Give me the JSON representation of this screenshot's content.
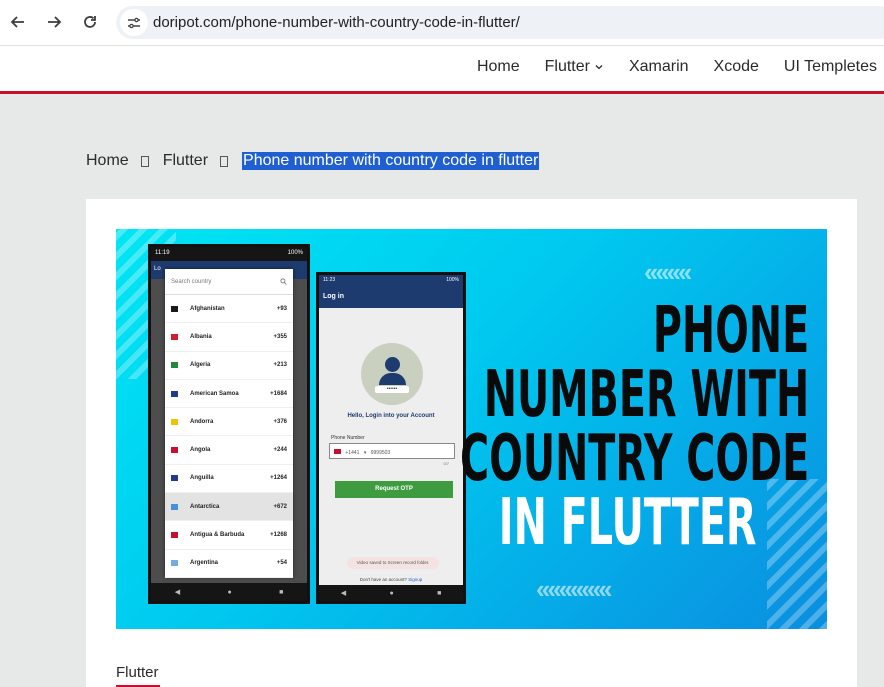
{
  "browser": {
    "url": "doripot.com/phone-number-with-country-code-in-flutter/",
    "back_icon": "arrow-left-icon",
    "forward_icon": "arrow-right-icon",
    "reload_icon": "reload-icon",
    "site_info_icon": "tune-icon"
  },
  "nav": {
    "items": [
      {
        "label": "Home"
      },
      {
        "label": "Flutter",
        "has_dropdown": true
      },
      {
        "label": "Xamarin"
      },
      {
        "label": "Xcode"
      },
      {
        "label": "UI Templetes"
      }
    ]
  },
  "breadcrumb": {
    "home": "Home",
    "section": "Flutter",
    "current": "Phone number with country code in flutter"
  },
  "banner": {
    "headline": [
      "PHONE",
      "NUMBER WITH",
      "COUNTRY CODE",
      "IN FLUTTER"
    ],
    "phone1": {
      "time": "11:19",
      "battery": "100%",
      "bar_label": "Lo",
      "search_placeholder": "Search country",
      "countries": [
        {
          "name": "Afghanistan",
          "code": "+93",
          "flag": "#1a1a1a"
        },
        {
          "name": "Albania",
          "code": "+355",
          "flag": "#d21f2b"
        },
        {
          "name": "Algeria",
          "code": "+213",
          "flag": "#1f8a3b"
        },
        {
          "name": "American Samoa",
          "code": "+1684",
          "flag": "#1d3b8f"
        },
        {
          "name": "Andorra",
          "code": "+376",
          "flag": "#f2c200"
        },
        {
          "name": "Angola",
          "code": "+244",
          "flag": "#c8102e"
        },
        {
          "name": "Anguilla",
          "code": "+1264",
          "flag": "#1d3b8f"
        },
        {
          "name": "Antarctica",
          "code": "+672",
          "flag": "#4a90d9",
          "selected": true
        },
        {
          "name": "Antigua & Barbuda",
          "code": "+1268",
          "flag": "#c8102e"
        },
        {
          "name": "Argentina",
          "code": "+54",
          "flag": "#74acdf"
        }
      ]
    },
    "phone2": {
      "time": "11:23",
      "battery": "100%",
      "title": "Log in",
      "pin_dots": "••••••",
      "greeting": "Hello, Login into your Account",
      "phone_label": "Phone Number",
      "phone_prefix": "+1441",
      "phone_value": "9999503",
      "counter": "0/7",
      "button": "Request OTP",
      "toast": "Video saved to Screen record folder.",
      "signup_text": "Don't have an account?",
      "signup_link": "Signup"
    }
  },
  "post": {
    "category": "Flutter"
  },
  "colors": {
    "accent": "#c8102e",
    "highlight": "#1f5fd1",
    "banner_cyan": "#00d4f2",
    "banner_blue": "#0a8ee0"
  }
}
